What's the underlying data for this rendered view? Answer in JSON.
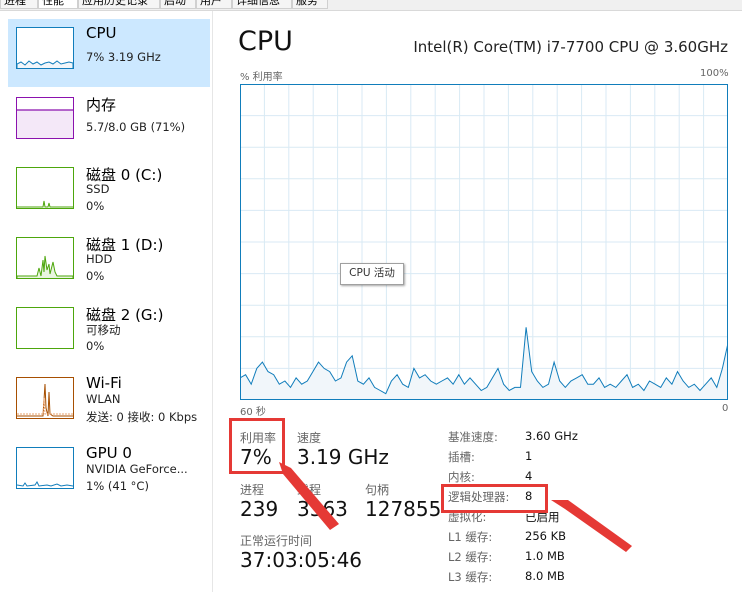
{
  "tabs": [
    "进程",
    "性能",
    "应用历史记录",
    "启动",
    "用户",
    "详细信息",
    "服务"
  ],
  "sidebar": {
    "items": [
      {
        "title": "CPU",
        "lines": [
          "7% 3.19 GHz"
        ],
        "color": "#117dbb"
      },
      {
        "title": "内存",
        "lines": [
          "5.7/8.0 GB (71%)"
        ],
        "color": "#8b12ae"
      },
      {
        "title": "磁盘 0 (C:)",
        "lines": [
          "SSD",
          "0%"
        ],
        "color": "#4da60c"
      },
      {
        "title": "磁盘 1 (D:)",
        "lines": [
          "HDD",
          "0%"
        ],
        "color": "#4da60c"
      },
      {
        "title": "磁盘 2 (G:)",
        "lines": [
          "可移动",
          "0%"
        ],
        "color": "#4da60c"
      },
      {
        "title": "Wi-Fi",
        "lines": [
          "WLAN",
          "发送: 0 接收: 0 Kbps"
        ],
        "color": "#a74f01"
      },
      {
        "title": "GPU 0",
        "lines": [
          "NVIDIA GeForce...",
          "1% (41 °C)"
        ],
        "color": "#117dbb"
      }
    ]
  },
  "main": {
    "title": "CPU",
    "model": "Intel(R) Core(TM) i7-7700 CPU @ 3.60GHz",
    "graph": {
      "y_label": "% 利用率",
      "y_max_label": "100%",
      "x_left_label": "60 秒",
      "x_right_label": "0",
      "tooltip": "CPU 活动",
      "line_color": "#117dbb",
      "fill_color": "#f1f6fa",
      "grid_color": "#d9eaf4"
    },
    "stats": {
      "utilization_label": "利用率",
      "utilization_value": "7%",
      "speed_label": "速度",
      "speed_value": "3.19 GHz",
      "processes_label": "进程",
      "processes_value": "239",
      "threads_label": "线程",
      "threads_value": "3363",
      "handles_label": "句柄",
      "handles_value": "127855",
      "uptime_label": "正常运行时间",
      "uptime_value": "37:03:05:46"
    },
    "specs": [
      {
        "label": "基准速度:",
        "value": "3.60 GHz"
      },
      {
        "label": "插槽:",
        "value": "1"
      },
      {
        "label": "内核:",
        "value": "4"
      },
      {
        "label": "逻辑处理器:",
        "value": "8"
      },
      {
        "label": "虚拟化:",
        "value": "已启用"
      },
      {
        "label": "L1 缓存:",
        "value": "256 KB"
      },
      {
        "label": "L2 缓存:",
        "value": "1.0 MB"
      },
      {
        "label": "L3 缓存:",
        "value": "8.0 MB"
      }
    ]
  },
  "cpu_history": [
    7,
    8,
    5,
    10,
    12,
    9,
    8,
    5,
    6,
    4,
    7,
    5,
    6,
    9,
    12,
    10,
    9,
    6,
    7,
    12,
    14,
    6,
    5,
    7,
    4,
    3,
    2,
    6,
    8,
    5,
    4,
    10,
    7,
    8,
    6,
    5,
    6,
    7,
    5,
    8,
    5,
    7,
    5,
    3,
    4,
    7,
    10,
    5,
    3,
    4,
    4,
    23,
    9,
    6,
    4,
    5,
    12,
    6,
    4,
    6,
    7,
    8,
    5,
    5,
    7,
    4,
    5,
    4,
    6,
    8,
    4,
    5,
    3,
    6,
    5,
    4,
    7,
    5,
    9,
    6,
    4,
    5,
    3,
    5,
    7,
    4,
    10,
    18
  ],
  "annotation_color": "#e53935"
}
